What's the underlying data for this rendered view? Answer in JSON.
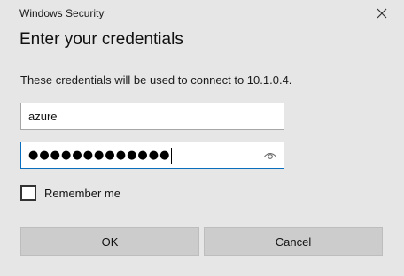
{
  "window": {
    "title": "Windows Security"
  },
  "dialog": {
    "heading": "Enter your credentials",
    "description": "These credentials will be used to connect to 10.1.0.4."
  },
  "username_field": {
    "value": "azure"
  },
  "password_field": {
    "masked_value": "●●●●●●●●●●●●●"
  },
  "remember_me": {
    "label": "Remember me",
    "checked": false
  },
  "buttons": {
    "ok_label": "OK",
    "cancel_label": "Cancel"
  },
  "icons": {
    "close": "close-icon",
    "reveal_password": "eye-icon"
  },
  "colors": {
    "background": "#e6e6e6",
    "focus_border": "#0a6ebd",
    "button_bg": "#cccccc"
  }
}
